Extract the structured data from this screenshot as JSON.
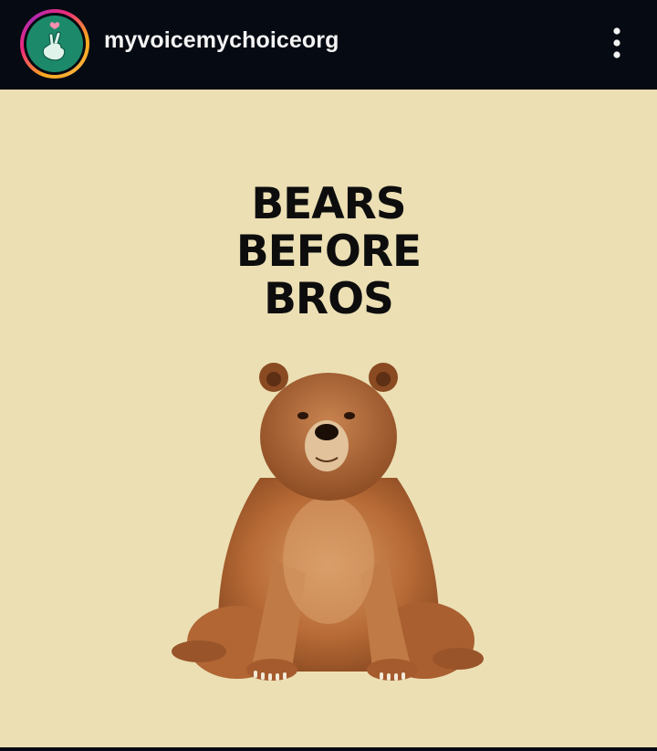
{
  "header": {
    "username": "myvoicemychoiceorg",
    "avatar_icon": "hand-heart-logo-icon",
    "more_icon": "more-options-vertical-icon"
  },
  "post": {
    "headline_lines": [
      "BEARS",
      "BEFORE",
      "BROS"
    ],
    "image_subject": "bear-illustration-icon",
    "background_color": "#ecdfb4"
  },
  "colors": {
    "topbar": "#060a12",
    "avatar_bg": "#1c8a6a",
    "text_light": "#f4f4f4",
    "text_dark": "#0d0d0d"
  }
}
